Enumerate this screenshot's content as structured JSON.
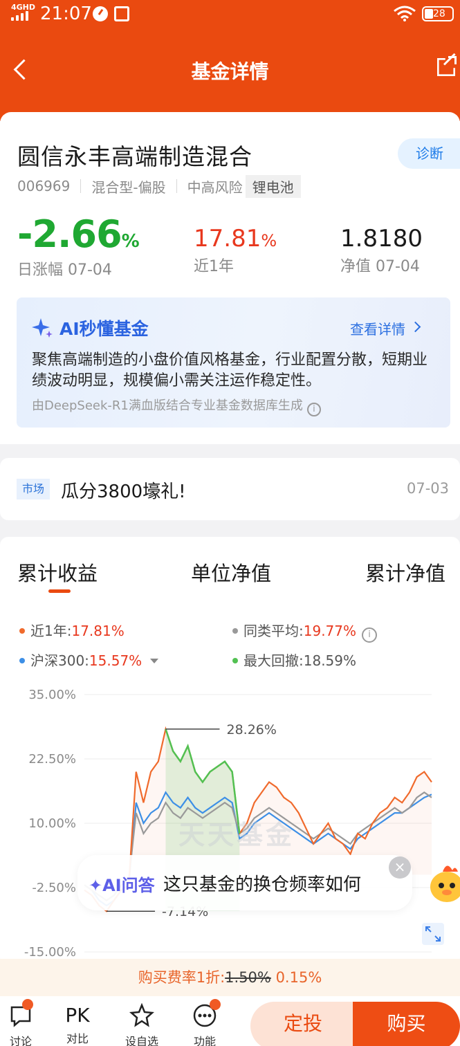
{
  "status": {
    "network": "4GHD",
    "time": "21:07",
    "battery": "28"
  },
  "header": {
    "title": "基金详情"
  },
  "fund": {
    "name": "圆信永丰高端制造混合",
    "diagnose_label": "诊断",
    "code": "006969",
    "type": "混合型-偏股",
    "risk": "中高风险",
    "theme": "锂电池",
    "daily_change": "-2.66",
    "daily_change_unit": "%",
    "daily_change_label": "日涨幅 07-04",
    "year_return": "17.81",
    "year_return_unit": "%",
    "year_return_label": "近1年",
    "nav": "1.8180",
    "nav_label": "净值 07-04"
  },
  "ai_summary": {
    "title": "AI秒懂基金",
    "more": "查看详情",
    "text": "聚焦高端制造的小盘价值风格基金，行业配置分散，短期业绩波动明显，规模偏小需关注运作稳定性。",
    "source": "由DeepSeek-R1满血版结合专业基金数据库生成"
  },
  "news": {
    "badge": "市场",
    "headline": "瓜分3800壕礼!",
    "date": "07-03"
  },
  "chart_tabs": [
    "累计收益",
    "单位净值",
    "累计净值"
  ],
  "legend": {
    "fund_label": "近1年:",
    "fund_value": "17.81%",
    "avg_label": "同类平均:",
    "avg_value": "19.77%",
    "index_label": "沪深300:",
    "index_value": "15.57%",
    "drawdown_label": "最大回撤:",
    "drawdown_value": "18.59%"
  },
  "colors": {
    "accent": "#ea4a10",
    "fund": "#f06a2c",
    "average": "#999999",
    "index": "#3d8fe6",
    "drawdown": "#52c152",
    "down": "#1fa832",
    "up": "#e8381e"
  },
  "chart_data": {
    "type": "line",
    "y_ticks": [
      "35.00%",
      "22.50%",
      "10.00%",
      "-2.50%",
      "-15.00%"
    ],
    "ylim": [
      -15,
      35
    ],
    "annotations": {
      "max": "28.26%",
      "min": "-7.14%"
    },
    "watermark": "天天基金",
    "series": [
      {
        "name": "近1年",
        "color": "#f06a2c",
        "values": [
          -3,
          -4,
          -6,
          -7.1,
          -5,
          -3,
          -2,
          20,
          14,
          20,
          22,
          28.3,
          24,
          22,
          25,
          20,
          18,
          20,
          21,
          22,
          20,
          8,
          10,
          14,
          16,
          18,
          17,
          15,
          14,
          12,
          9,
          6,
          8,
          10,
          7,
          6,
          4,
          8,
          7,
          10,
          12,
          13,
          15,
          14,
          16,
          19,
          20,
          18
        ]
      },
      {
        "name": "同类平均",
        "color": "#999999",
        "values": [
          -2,
          -3,
          -4,
          -5,
          -4,
          -2,
          -1,
          12,
          8,
          10,
          11,
          14,
          12,
          11,
          13,
          12,
          11,
          12,
          13,
          14,
          13,
          8,
          9,
          11,
          12,
          13,
          12,
          11,
          10,
          9,
          8,
          7,
          8,
          9,
          8,
          7,
          6,
          8,
          9,
          10,
          11,
          12,
          13,
          12,
          13,
          15,
          16,
          15
        ]
      },
      {
        "name": "沪深300",
        "color": "#3d8fe6",
        "values": [
          -2,
          -3,
          -5,
          -6,
          -5,
          -3,
          -2,
          14,
          10,
          12,
          13,
          16,
          14,
          13,
          15,
          13,
          12,
          13,
          14,
          15,
          14,
          7,
          8,
          10,
          11,
          12,
          11,
          10,
          9,
          8,
          7,
          6,
          7,
          8,
          7,
          6,
          5,
          7,
          8,
          9,
          10,
          11,
          12,
          12,
          13,
          14,
          15,
          15.6
        ]
      }
    ]
  },
  "ai_qa": {
    "tag": "AI问答",
    "question": "这只基金的换仓频率如何"
  },
  "fee": {
    "prefix": "购买费率1折:",
    "original": "1.50%",
    "discounted": "0.15%"
  },
  "bottom_nav": {
    "discuss": "讨论",
    "pk": "对比",
    "pk_icon": "PK",
    "watch": "设自选",
    "func": "功能",
    "sip": "定投",
    "buy": "购买"
  }
}
